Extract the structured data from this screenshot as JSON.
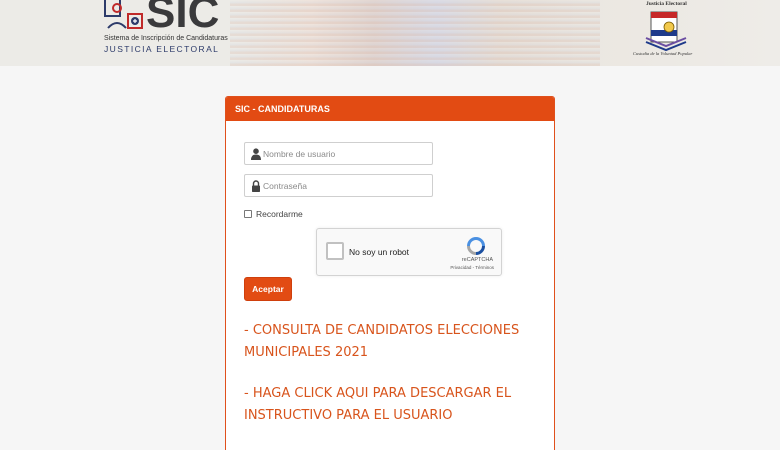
{
  "header": {
    "logo_title": "SIC",
    "logo_subtitle": "Sistema de Inscripción de Candidaturas",
    "logo_org": "JUSTICIA ELECTORAL",
    "right_logo_top": "Justicia Electoral",
    "right_logo_bottom": "Custodia de la Voluntad Popular",
    "icons": [
      "sic-logo-icon",
      "justicia-electoral-emblem-icon"
    ]
  },
  "panel": {
    "title": "SIC - CANDIDATURAS",
    "username": {
      "value": "",
      "placeholder": "Nombre de usuario",
      "icon": "user-icon"
    },
    "password": {
      "value": "",
      "placeholder": "Contraseña",
      "icon": "lock-icon"
    },
    "remember_label": "Recordarme",
    "remember_checked": false,
    "captcha": {
      "label": "No soy un robot",
      "brand": "reCAPTCHA",
      "links": "Privacidad - Términos",
      "icon": "recaptcha-icon"
    },
    "submit_label": "Aceptar",
    "links": [
      {
        "line1": "- CONSULTA DE CANDIDATOS ELECCIONES",
        "line2": "MUNICIPALES 2021"
      },
      {
        "line1": "- HAGA CLICK AQUI PARA DESCARGAR EL",
        "line2": "INSTRUCTIVO PARA EL USUARIO"
      }
    ]
  },
  "colors": {
    "accent": "#e24b13",
    "link": "#d8541c",
    "page_bg": "#f6f6f6"
  }
}
